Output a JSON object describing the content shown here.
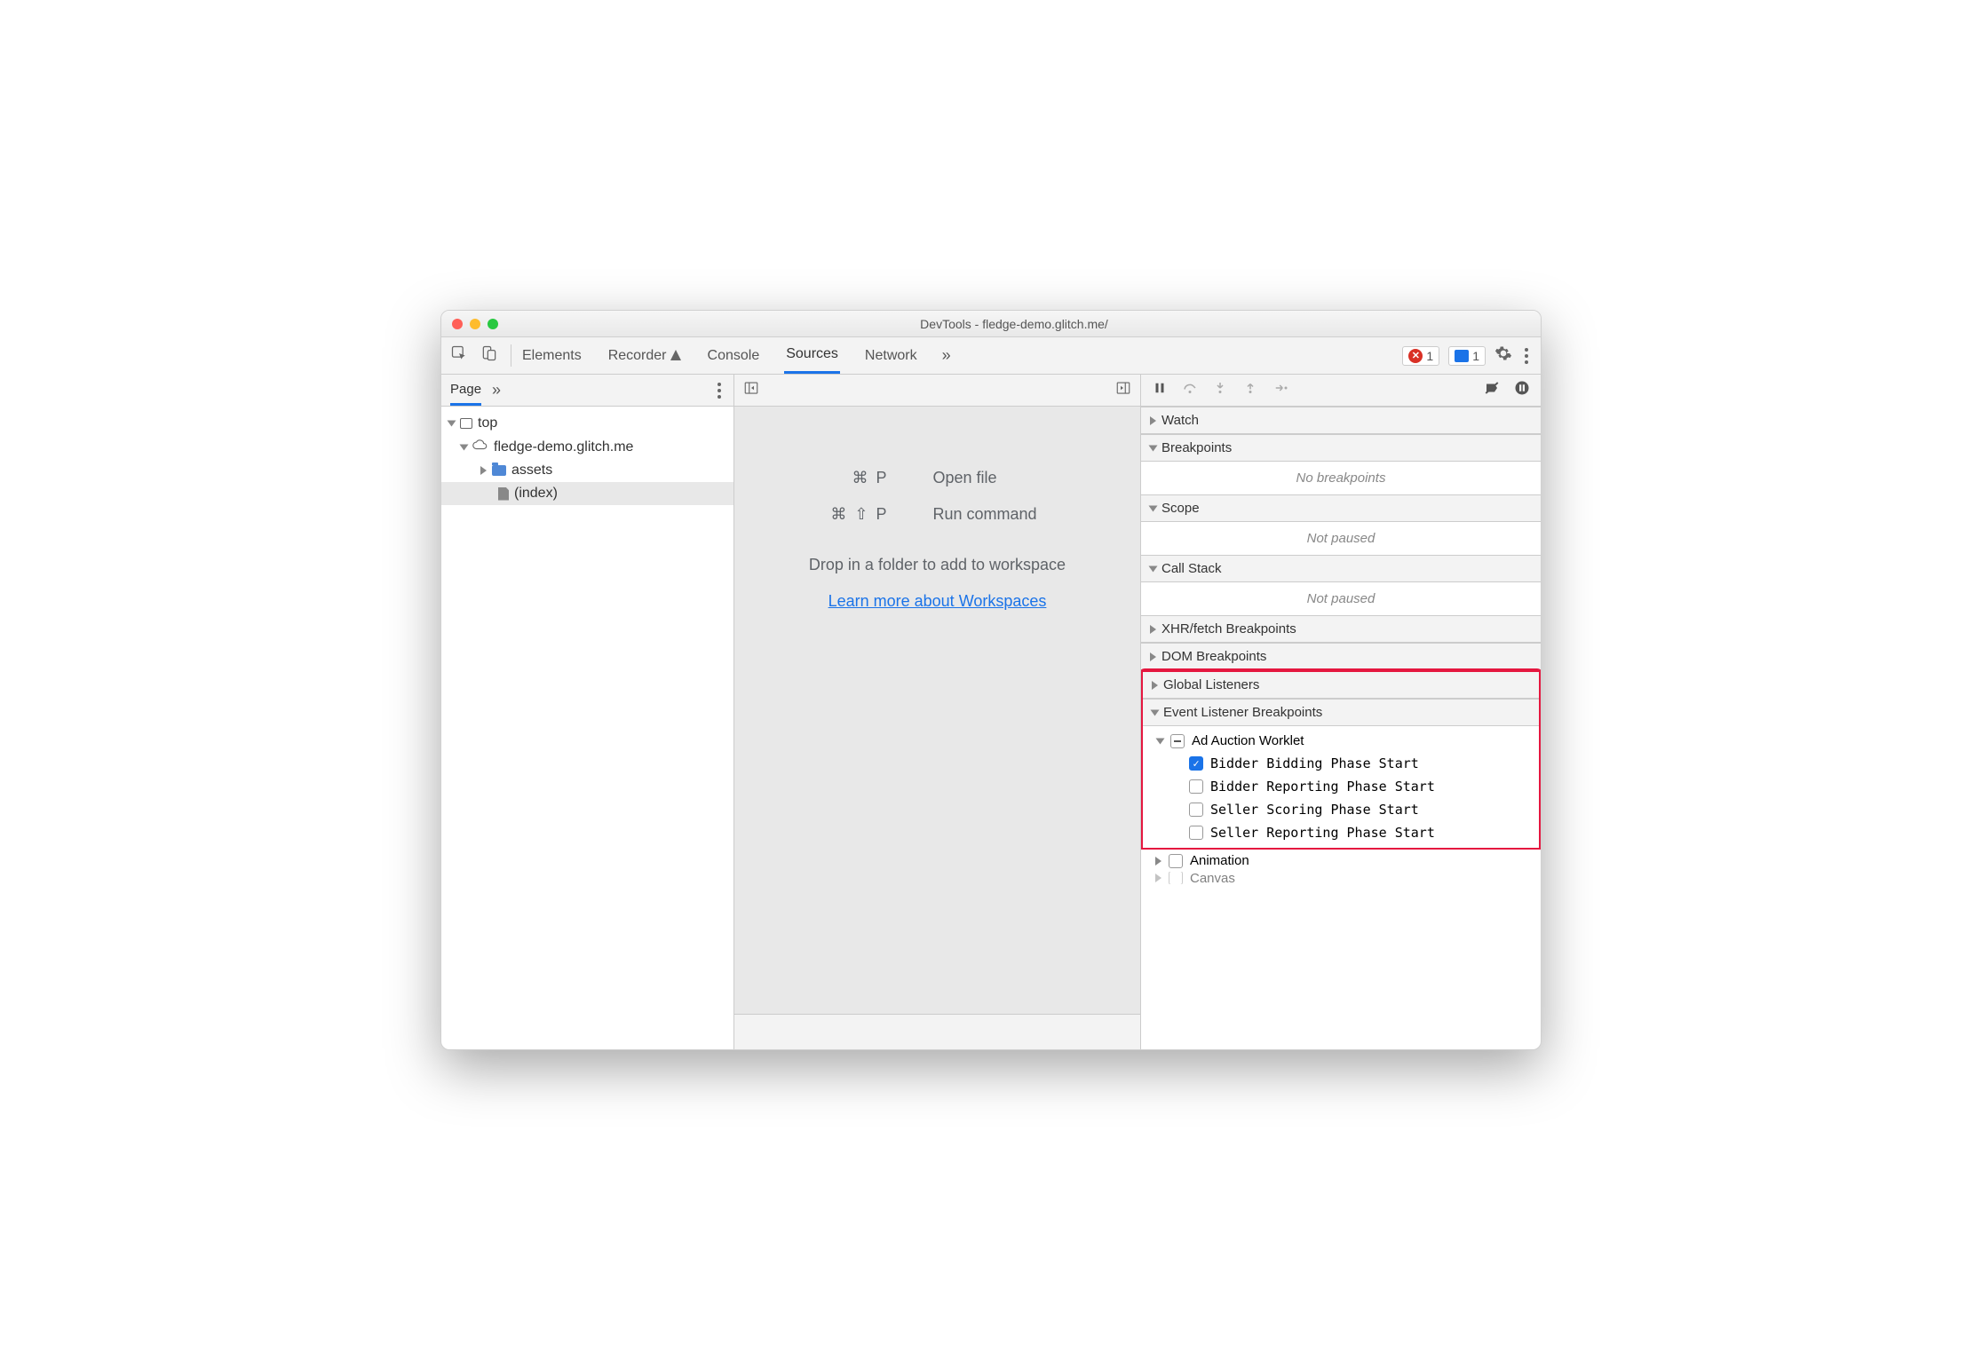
{
  "window": {
    "title": "DevTools - fledge-demo.glitch.me/"
  },
  "toolbar": {
    "tabs": [
      "Elements",
      "Recorder",
      "Console",
      "Sources",
      "Network"
    ],
    "active_tab": "Sources",
    "errors_count": "1",
    "messages_count": "1"
  },
  "page_panel": {
    "tab": "Page",
    "tree": {
      "top": "top",
      "origin": "fledge-demo.glitch.me",
      "folder": "assets",
      "file": "(index)"
    }
  },
  "editor_hints": {
    "open_file_key": "⌘ P",
    "open_file_label": "Open file",
    "run_cmd_key": "⌘ ⇧ P",
    "run_cmd_label": "Run command",
    "drop_text": "Drop in a folder to add to workspace",
    "learn_link": "Learn more about Workspaces"
  },
  "debugger": {
    "sections": {
      "watch": "Watch",
      "breakpoints": "Breakpoints",
      "breakpoints_body": "No breakpoints",
      "scope": "Scope",
      "scope_body": "Not paused",
      "callstack": "Call Stack",
      "callstack_body": "Not paused",
      "xhr": "XHR/fetch Breakpoints",
      "dom": "DOM Breakpoints",
      "global": "Global Listeners",
      "elb": "Event Listener Breakpoints"
    },
    "ad_auction": {
      "label": "Ad Auction Worklet",
      "items": [
        {
          "label": "Bidder Bidding Phase Start",
          "checked": true
        },
        {
          "label": "Bidder Reporting Phase Start",
          "checked": false
        },
        {
          "label": "Seller Scoring Phase Start",
          "checked": false
        },
        {
          "label": "Seller Reporting Phase Start",
          "checked": false
        }
      ]
    },
    "animation": "Animation",
    "canvas": "Canvas"
  }
}
